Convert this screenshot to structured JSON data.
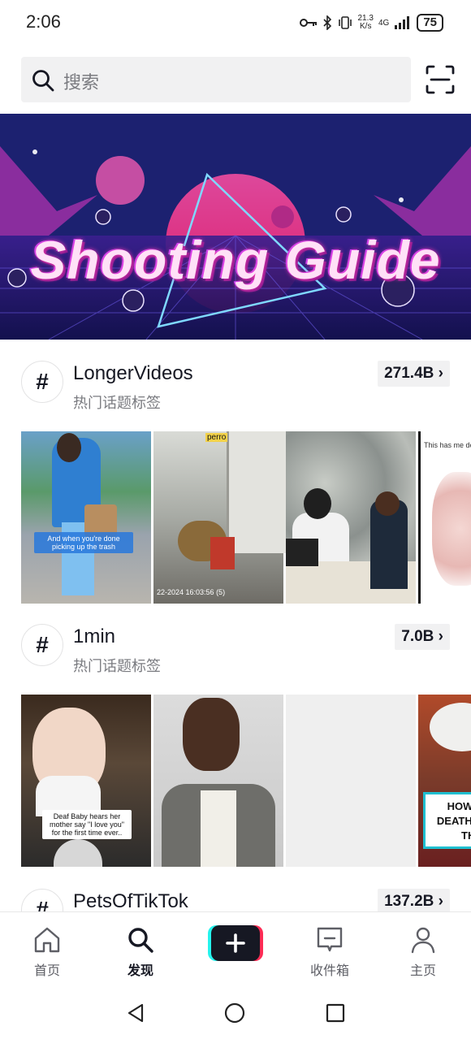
{
  "status": {
    "time": "2:06",
    "speed_top": "21.3",
    "speed_bottom": "K/s",
    "net": "4G",
    "battery": "75"
  },
  "search": {
    "placeholder": "搜索"
  },
  "banner": {
    "title": "Shooting Guide"
  },
  "topics": [
    {
      "name": "LongerVideos",
      "subtitle": "热门话题标签",
      "count": "271.4B",
      "thumb_captions": [
        "And when you're done picking up the trash",
        "perro",
        "22-2024 16:03:56 (5)",
        "",
        "This has me de"
      ]
    },
    {
      "name": "1min",
      "subtitle": "热门话题标签",
      "count": "7.0B",
      "thumb_captions": [
        "Deaf Baby hears her mother say \"I love you\" for the first time ever..",
        "HOW T DEATH V THE"
      ]
    },
    {
      "name": "PetsOfTikTok",
      "subtitle": "",
      "count": "137.2B"
    }
  ],
  "tabbar": {
    "home": "首页",
    "discover": "发现",
    "inbox": "收件箱",
    "profile": "主页"
  },
  "colors": {
    "accent_pink": "#fe2c55",
    "accent_cyan": "#25f4ee",
    "text": "#161823",
    "muted": "#7a7b80"
  }
}
